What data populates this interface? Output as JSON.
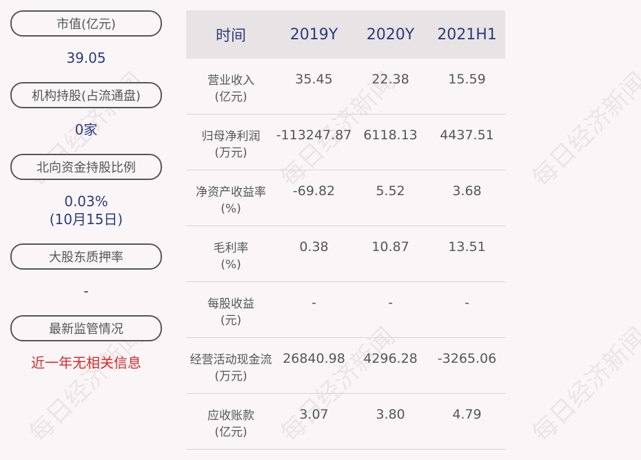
{
  "left": {
    "items": [
      {
        "label": "市值(亿元)",
        "value": "39.05"
      },
      {
        "label": "机构持股(占流通盘)",
        "value": "0家"
      },
      {
        "label": "北向资金持股比例",
        "value": "0.03%",
        "value2": "(10月15日)"
      },
      {
        "label": "大股东质押率",
        "value": "-"
      },
      {
        "label": "最新监管情况",
        "value": "近一年无相关信息"
      }
    ]
  },
  "table": {
    "headers": [
      "时间",
      "2019Y",
      "2020Y",
      "2021H1"
    ],
    "rows": [
      {
        "label1": "营业收入",
        "label2": "(亿元)",
        "values": [
          "35.45",
          "22.38",
          "15.59"
        ]
      },
      {
        "label1": "归母净利润",
        "label2": "(万元)",
        "values": [
          "-113247.87",
          "6118.13",
          "4437.51"
        ]
      },
      {
        "label1": "净资产收益率",
        "label2": "(%)",
        "values": [
          "-69.82",
          "5.52",
          "3.68"
        ]
      },
      {
        "label1": "毛利率",
        "label2": "(%)",
        "values": [
          "0.38",
          "10.87",
          "13.51"
        ]
      },
      {
        "label1": "每股收益",
        "label2": "(元)",
        "values": [
          "-",
          "-",
          "-"
        ]
      },
      {
        "label1": "经营活动现金流",
        "label2": "(万元)",
        "values": [
          "26840.98",
          "4296.28",
          "-3265.06"
        ]
      },
      {
        "label1": "应收账款",
        "label2": "(亿元)",
        "values": [
          "3.07",
          "3.80",
          "4.79"
        ]
      }
    ]
  },
  "watermark": "每日经济新闻",
  "colors": {
    "accent": "#2c3a7c",
    "alert": "#d62a2a"
  }
}
